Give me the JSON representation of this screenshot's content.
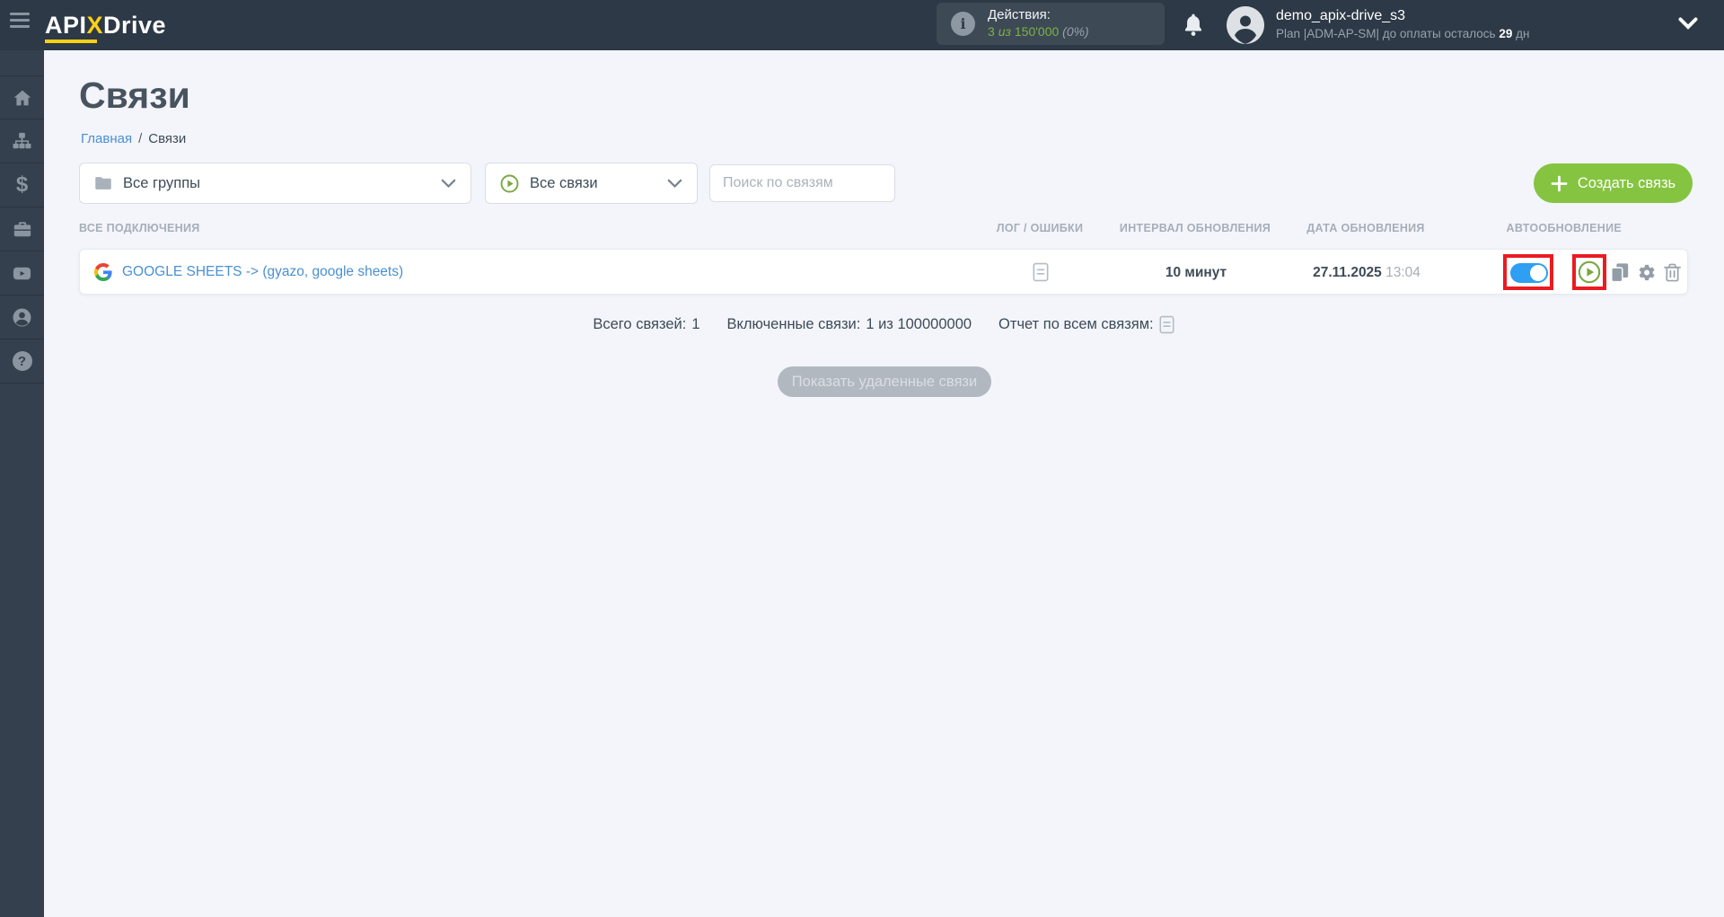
{
  "header": {
    "logo_api": "API",
    "logo_x": "X",
    "logo_drive": "Drive",
    "actions_label": "Действия:",
    "actions_used": "3",
    "actions_of": "из",
    "actions_limit": "150'000",
    "actions_percent": "(0%)",
    "user_name": "demo_apix-drive_s3",
    "user_plan_prefix": "Plan |ADM-AP-SM| до оплаты осталось",
    "user_days": "29",
    "user_days_suffix": "дн"
  },
  "sidebar": {
    "items": [
      {
        "icon": "home-icon"
      },
      {
        "icon": "connections-icon"
      },
      {
        "icon": "payments-icon"
      },
      {
        "icon": "services-icon"
      },
      {
        "icon": "youtube-icon"
      },
      {
        "icon": "account-icon"
      },
      {
        "icon": "help-icon"
      }
    ]
  },
  "page": {
    "title": "Связи",
    "breadcrumb_home": "Главная",
    "breadcrumb_sep": "/",
    "breadcrumb_current": "Связи",
    "filter_groups": "Все группы",
    "filter_links": "Все связи",
    "search_placeholder": "Поиск по связям",
    "create_plus": "+",
    "create_button": "Создать связь",
    "table_headers": [
      "ВСЕ ПОДКЛЮЧЕНИЯ",
      "ЛОГ / ОШИБКИ",
      "ИНТЕРВАЛ ОБНОВЛЕНИЯ",
      "ДАТА ОБНОВЛЕНИЯ",
      "АВТООБНОВЛЕНИЕ"
    ],
    "row": {
      "name": "GOOGLE SHEETS -> (gyazo, google sheets)",
      "interval": "10 минут",
      "date": "27.11.2025",
      "time": "13:04",
      "autoupdate_on": true
    },
    "summary_total_label": "Всего связей:",
    "summary_total_value": "1",
    "summary_enabled_label": "Включенные связи:",
    "summary_enabled_value": "1 из 100000000",
    "summary_report_label": "Отчет по всем связям:",
    "show_deleted_button": "Показать удаленные связи"
  },
  "colors": {
    "accent_green": "#85c441",
    "toggle_blue": "#2e9ff2",
    "link_blue": "#4a90d2",
    "highlight_red": "#ea1b22",
    "brand_yellow": "#ffd014",
    "header_dark": "#2d3946",
    "sidebar_dark": "#35404e"
  }
}
